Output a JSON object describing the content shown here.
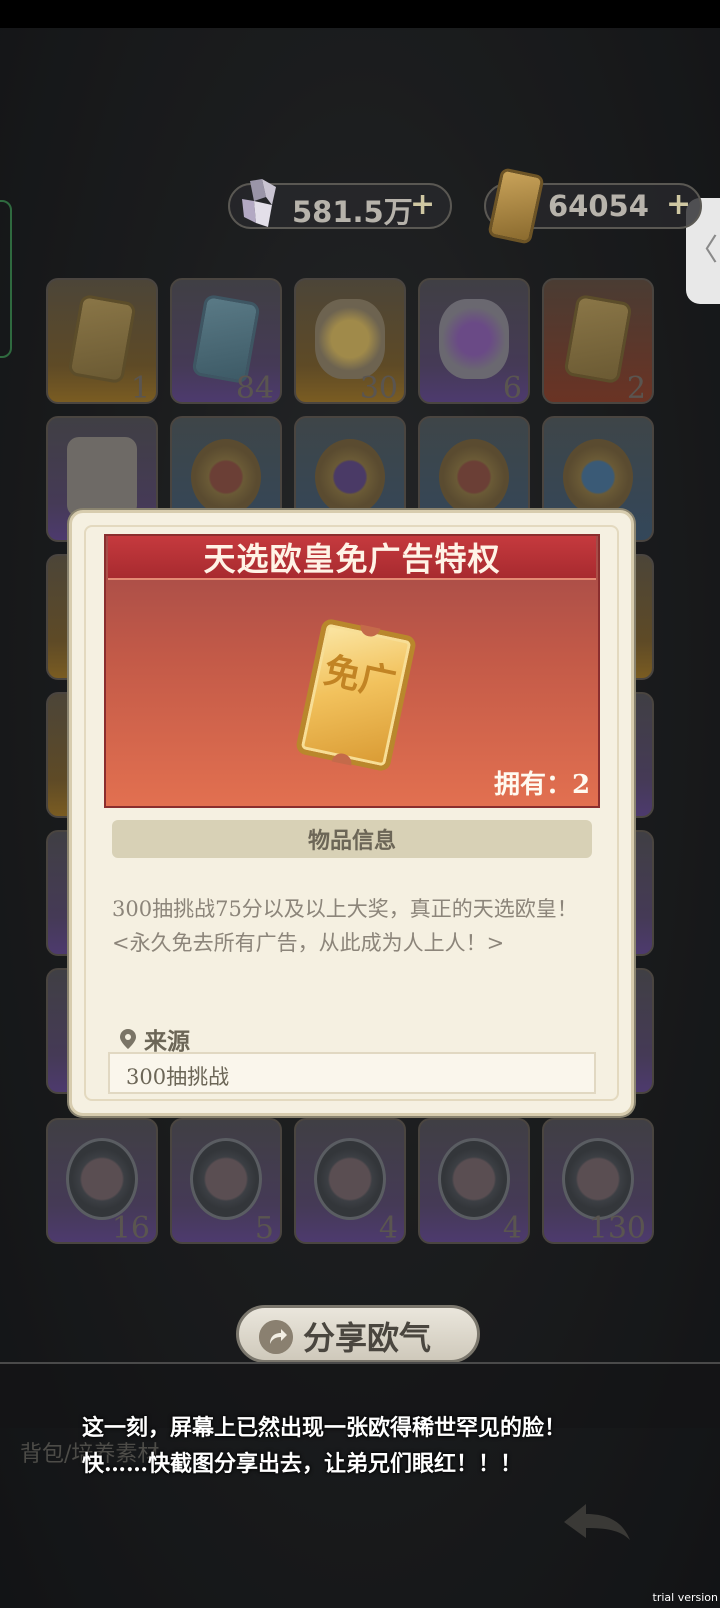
{
  "currency": {
    "crystals": "581.5万",
    "tickets": "64054",
    "plus": "+"
  },
  "side_handle": {
    "glyph": "〈"
  },
  "inventory": {
    "counts_row1": [
      "1",
      "84",
      "30",
      "6",
      "2"
    ],
    "counts_row6": [
      "16",
      "5",
      "4",
      "4",
      "130"
    ]
  },
  "modal": {
    "title": "天选欧皇免广告特权",
    "ticket_text": "免广",
    "owned": "拥有：2",
    "section_header": "物品信息",
    "description_line1": "300抽挑战75分以及以上大奖，真正的天选欧皇！",
    "description_line2": "<永久免去所有广告，从此成为人上人！>",
    "source_label": "来源",
    "source_value": "300抽挑战"
  },
  "share": {
    "button_label": "分享欧气",
    "line1": "这一刻，屏幕上已然出现一张欧得稀世罕见的脸！",
    "line2": "快……快截图分享出去，让弟兄们眼红！！！"
  },
  "bottom": {
    "bag_label": "背包/培养素材"
  },
  "watermark": "trial version"
}
